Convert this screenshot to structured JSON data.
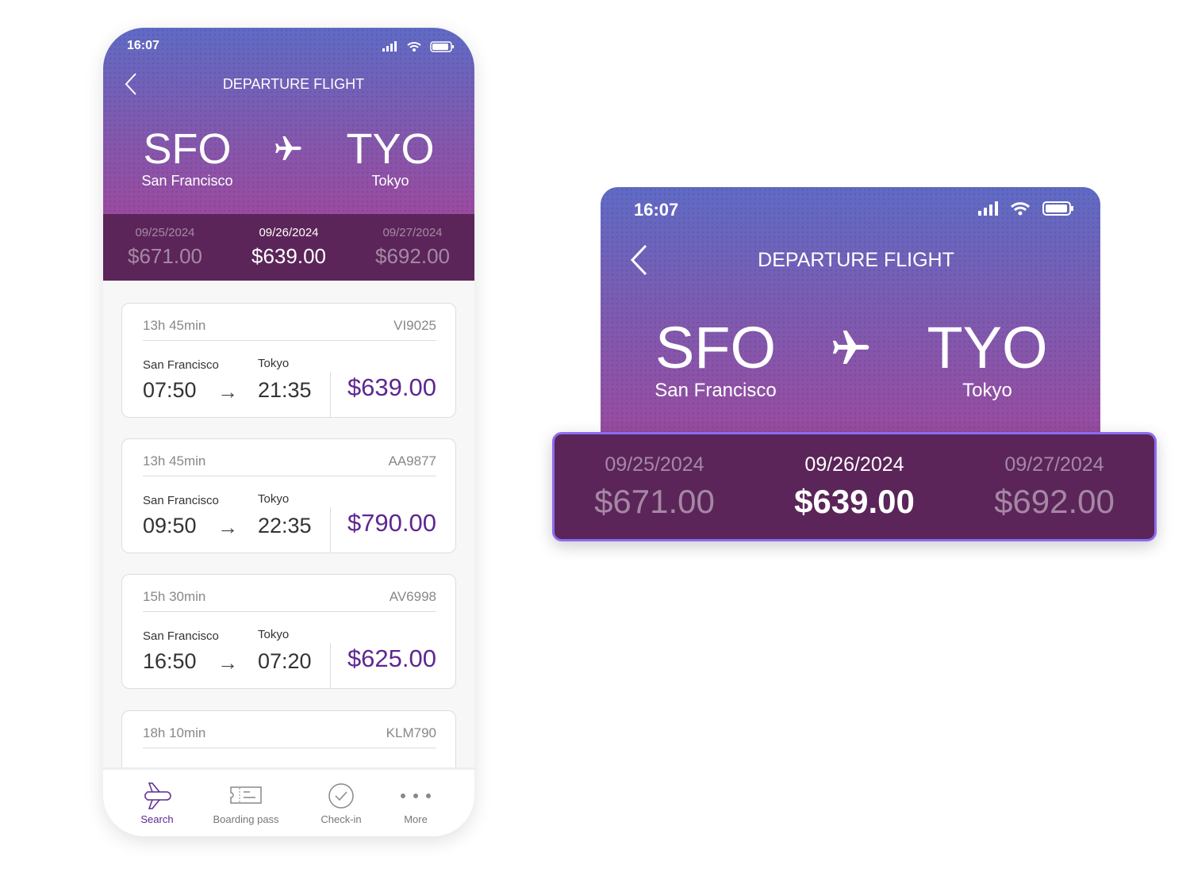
{
  "status": {
    "time": "16:07"
  },
  "header": {
    "title": "DEPARTURE FLIGHT",
    "origin_code": "SFO",
    "origin_city": "San Francisco",
    "dest_code": "TYO",
    "dest_city": "Tokyo"
  },
  "dates": [
    {
      "date": "09/25/2024",
      "price": "$671.00",
      "selected": false
    },
    {
      "date": "09/26/2024",
      "price": "$639.00",
      "selected": true
    },
    {
      "date": "09/27/2024",
      "price": "$692.00",
      "selected": false
    }
  ],
  "flights": [
    {
      "duration": "13h 45min",
      "code": "VI9025",
      "from": "San Francisco",
      "to": "Tokyo",
      "dep": "07:50",
      "arr": "21:35",
      "price": "$639.00"
    },
    {
      "duration": "13h 45min",
      "code": "AA9877",
      "from": "San Francisco",
      "to": "Tokyo",
      "dep": "09:50",
      "arr": "22:35",
      "price": "$790.00"
    },
    {
      "duration": "15h 30min",
      "code": "AV6998",
      "from": "San Francisco",
      "to": "Tokyo",
      "dep": "16:50",
      "arr": "07:20",
      "price": "$625.00"
    },
    {
      "duration": "18h 10min",
      "code": "KLM790"
    }
  ],
  "nav": [
    {
      "label": "Search",
      "icon": "airplane-icon",
      "active": true
    },
    {
      "label": "Boarding pass",
      "icon": "ticket-icon"
    },
    {
      "label": "Check-in",
      "icon": "check-circle-icon"
    },
    {
      "label": "More",
      "icon": "more-dots-icon"
    }
  ],
  "colors": {
    "accent": "#5e2790",
    "date_bar": "#5b2559",
    "highlight_border": "#8b6cf0"
  }
}
